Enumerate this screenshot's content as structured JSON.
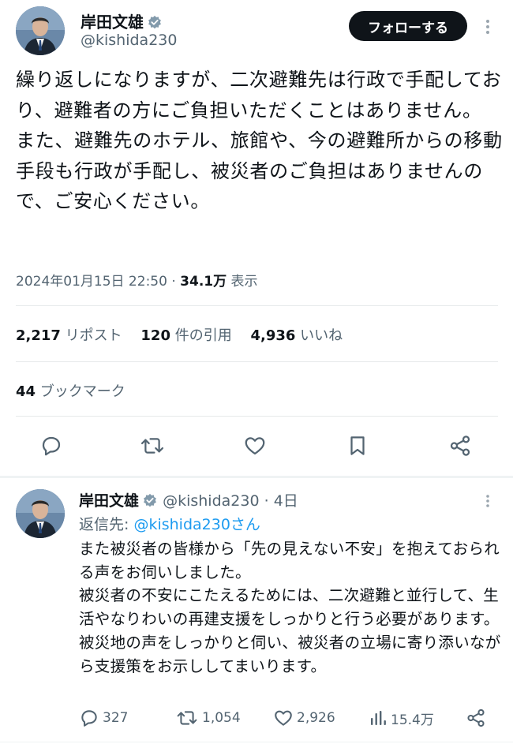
{
  "tweet": {
    "author_name": "岸田文雄",
    "author_handle": "@kishida230",
    "follow_label": "フォローする",
    "text": "繰り返しになりますが、二次避難先は行政で手配しており、避難者の方にご負担いただくことはありません。\nまた、避難先のホテル、旅館や、今の避難所からの移動手段も行政が手配し、被災者のご負担はありませんので、ご安心ください。",
    "timestamp": "2024年01月15日 22:50",
    "separator": "·",
    "views_count": "34.1万",
    "views_label": "表示",
    "reposts_count": "2,217",
    "reposts_label": "リポスト",
    "quotes_count": "120",
    "quotes_label": "件の引用",
    "likes_count": "4,936",
    "likes_label": "いいね",
    "bookmarks_count": "44",
    "bookmarks_label": "ブックマーク"
  },
  "reply": {
    "author_name": "岸田文雄",
    "author_handle": "@kishida230",
    "separator": "·",
    "age": "4日",
    "reply_to_label": "返信先:",
    "reply_to_target": "@kishida230さん",
    "text": "また被災者の皆様から「先の見えない不安」を抱えておられる声をお伺いしました。\n被災者の不安にこたえるためには、二次避難と並行して、生活やなりわいの再建支援をしっかりと行う必要があります。\n被災地の声をしっかりと伺い、被災者の立場に寄り添いながら支援策をお示ししてまいります。",
    "replies": "327",
    "retweets": "1,054",
    "likes": "2,926",
    "views": "15.4万"
  },
  "icons": [
    "verified-icon",
    "more-icon",
    "reply-icon",
    "retweet-icon",
    "like-icon",
    "bookmark-icon",
    "share-icon",
    "views-icon"
  ],
  "colors": {
    "verified": "#829aab",
    "link": "#1d9bf0",
    "muted": "#536471",
    "text": "#0f1419"
  }
}
